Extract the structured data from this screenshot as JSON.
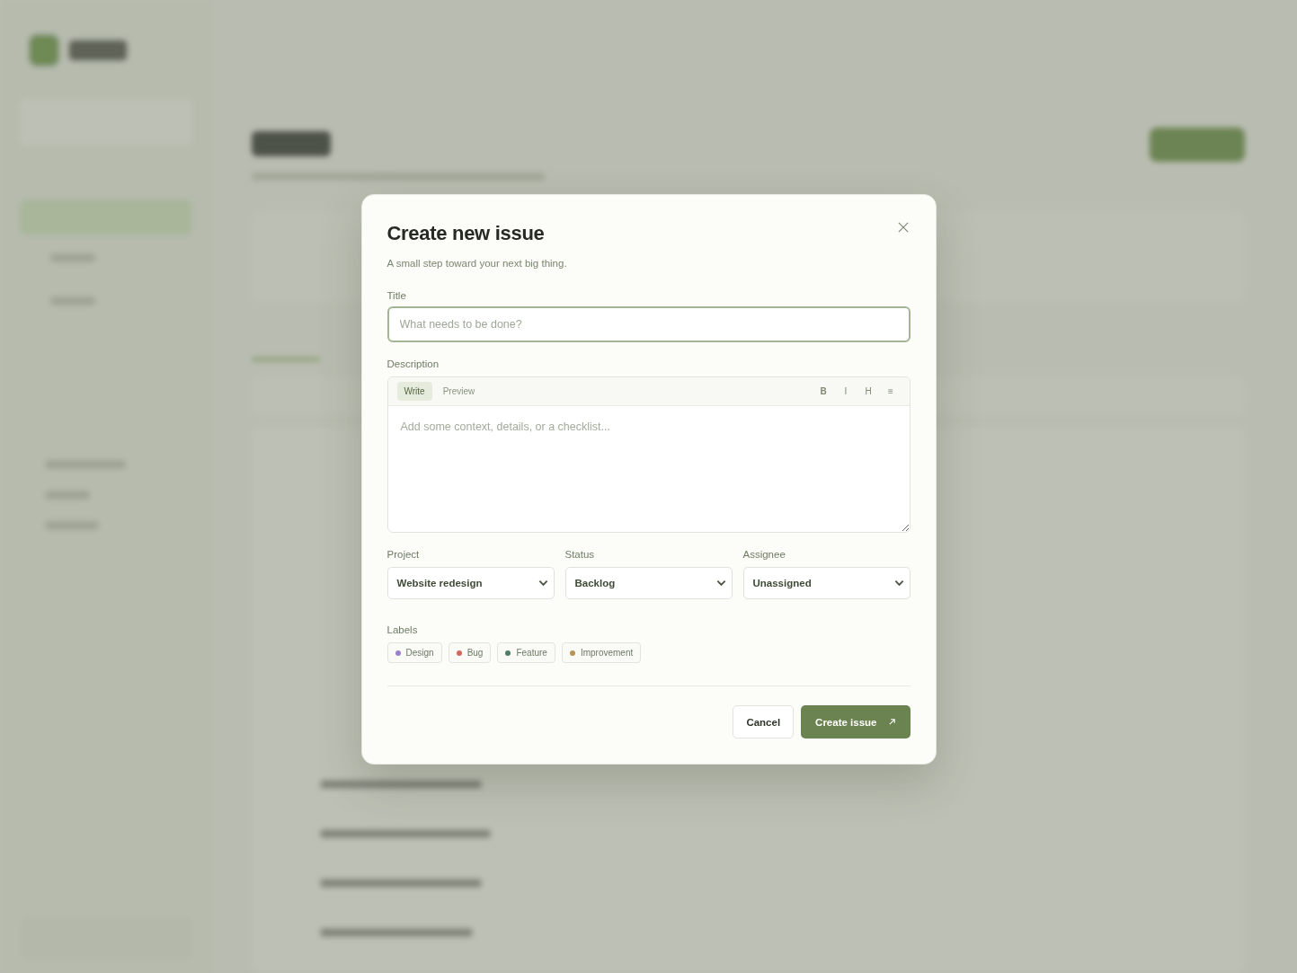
{
  "dialog": {
    "title": "Create new issue",
    "subtitle": "A small step toward your next big thing.",
    "title_field": {
      "label": "Title",
      "placeholder": "What needs to be done?"
    },
    "description": {
      "label": "Description",
      "tabs": [
        {
          "label": "Write",
          "selected": true
        },
        {
          "label": "Preview",
          "selected": false
        }
      ],
      "format_buttons": [
        "B",
        "I",
        "H",
        "≡"
      ],
      "placeholder": "Add some context, details, or a checklist..."
    },
    "selects": [
      {
        "label": "Project",
        "value": "Website redesign"
      },
      {
        "label": "Status",
        "value": "Backlog"
      },
      {
        "label": "Assignee",
        "value": "Unassigned"
      }
    ],
    "labels_heading": "Labels",
    "labels": [
      {
        "name": "Design",
        "color": "#9a80c6"
      },
      {
        "name": "Bug",
        "color": "#d2665c"
      },
      {
        "name": "Feature",
        "color": "#4f7e63"
      },
      {
        "name": "Improvement",
        "color": "#b79458"
      }
    ],
    "buttons": {
      "cancel": "Cancel",
      "create": "Create issue"
    }
  }
}
